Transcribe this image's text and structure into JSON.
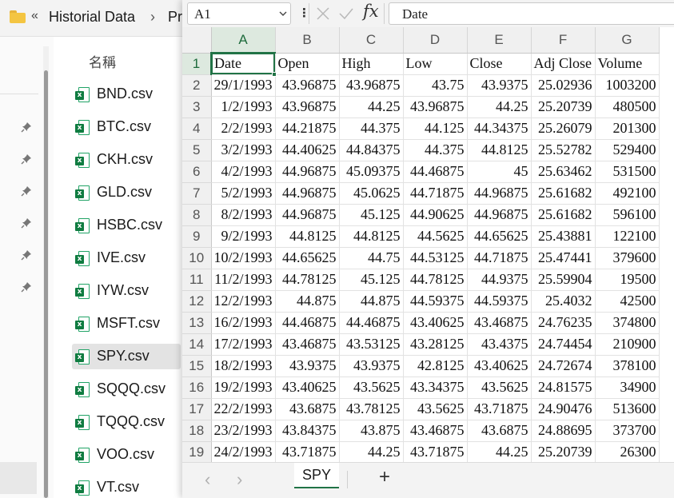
{
  "explorer": {
    "breadcrumb_chevron": "«",
    "breadcrumb_1": "Historial Data",
    "breadcrumb_sep": "›",
    "breadcrumb_2": "Pr",
    "column_header": "名稱",
    "files": [
      {
        "name": "BND.csv",
        "selected": false
      },
      {
        "name": "BTC.csv",
        "selected": false
      },
      {
        "name": "CKH.csv",
        "selected": false
      },
      {
        "name": "GLD.csv",
        "selected": false
      },
      {
        "name": "HSBC.csv",
        "selected": false
      },
      {
        "name": "IVE.csv",
        "selected": false
      },
      {
        "name": "IYW.csv",
        "selected": false
      },
      {
        "name": "MSFT.csv",
        "selected": false
      },
      {
        "name": "SPY.csv",
        "selected": true
      },
      {
        "name": "SQQQ.csv",
        "selected": false
      },
      {
        "name": "TQQQ.csv",
        "selected": false
      },
      {
        "name": "VOO.csv",
        "selected": false
      },
      {
        "name": "VT.csv",
        "selected": false
      }
    ],
    "file_icon": "excel-csv-icon",
    "pin_icon": "pin-icon"
  },
  "formula_bar": {
    "name_box": "A1",
    "more_icon": "⋮",
    "fx_label": "fx",
    "formula": "Date"
  },
  "sheet": {
    "columns": [
      "A",
      "B",
      "C",
      "D",
      "E",
      "F",
      "G"
    ],
    "active_column": "A",
    "active_row": "1",
    "rows": [
      {
        "n": "1",
        "cells": [
          "Date",
          "Open",
          "High",
          "Low",
          "Close",
          "Adj Close",
          "Volume"
        ]
      },
      {
        "n": "2",
        "cells": [
          "29/1/1993",
          "43.96875",
          "43.96875",
          "43.75",
          "43.9375",
          "25.02936",
          "1003200"
        ]
      },
      {
        "n": "3",
        "cells": [
          "1/2/1993",
          "43.96875",
          "44.25",
          "43.96875",
          "44.25",
          "25.20739",
          "480500"
        ]
      },
      {
        "n": "4",
        "cells": [
          "2/2/1993",
          "44.21875",
          "44.375",
          "44.125",
          "44.34375",
          "25.26079",
          "201300"
        ]
      },
      {
        "n": "5",
        "cells": [
          "3/2/1993",
          "44.40625",
          "44.84375",
          "44.375",
          "44.8125",
          "25.52782",
          "529400"
        ]
      },
      {
        "n": "6",
        "cells": [
          "4/2/1993",
          "44.96875",
          "45.09375",
          "44.46875",
          "45",
          "25.63462",
          "531500"
        ]
      },
      {
        "n": "7",
        "cells": [
          "5/2/1993",
          "44.96875",
          "45.0625",
          "44.71875",
          "44.96875",
          "25.61682",
          "492100"
        ]
      },
      {
        "n": "8",
        "cells": [
          "8/2/1993",
          "44.96875",
          "45.125",
          "44.90625",
          "44.96875",
          "25.61682",
          "596100"
        ]
      },
      {
        "n": "9",
        "cells": [
          "9/2/1993",
          "44.8125",
          "44.8125",
          "44.5625",
          "44.65625",
          "25.43881",
          "122100"
        ]
      },
      {
        "n": "10",
        "cells": [
          "10/2/1993",
          "44.65625",
          "44.75",
          "44.53125",
          "44.71875",
          "25.47441",
          "379600"
        ]
      },
      {
        "n": "11",
        "cells": [
          "11/2/1993",
          "44.78125",
          "45.125",
          "44.78125",
          "44.9375",
          "25.59904",
          "19500"
        ]
      },
      {
        "n": "12",
        "cells": [
          "12/2/1993",
          "44.875",
          "44.875",
          "44.59375",
          "44.59375",
          "25.4032",
          "42500"
        ]
      },
      {
        "n": "13",
        "cells": [
          "16/2/1993",
          "44.46875",
          "44.46875",
          "43.40625",
          "43.46875",
          "24.76235",
          "374800"
        ]
      },
      {
        "n": "14",
        "cells": [
          "17/2/1993",
          "43.46875",
          "43.53125",
          "43.28125",
          "43.4375",
          "24.74454",
          "210900"
        ]
      },
      {
        "n": "15",
        "cells": [
          "18/2/1993",
          "43.9375",
          "43.9375",
          "42.8125",
          "43.40625",
          "24.72674",
          "378100"
        ]
      },
      {
        "n": "16",
        "cells": [
          "19/2/1993",
          "43.40625",
          "43.5625",
          "43.34375",
          "43.5625",
          "24.81575",
          "34900"
        ]
      },
      {
        "n": "17",
        "cells": [
          "22/2/1993",
          "43.6875",
          "43.78125",
          "43.5625",
          "43.71875",
          "24.90476",
          "513600"
        ]
      },
      {
        "n": "18",
        "cells": [
          "23/2/1993",
          "43.84375",
          "43.875",
          "43.46875",
          "43.6875",
          "24.88695",
          "373700"
        ]
      },
      {
        "n": "19",
        "cells": [
          "24/2/1993",
          "43.71875",
          "44.25",
          "43.71875",
          "44.25",
          "25.20739",
          "26300"
        ]
      }
    ]
  },
  "tabs": {
    "prev": "‹",
    "next": "›",
    "sheet_name": "SPY",
    "add": "+"
  },
  "colors": {
    "accent": "#217346",
    "header_bg": "#f0f0f0",
    "selected_file_bg": "#e3e3e3"
  }
}
